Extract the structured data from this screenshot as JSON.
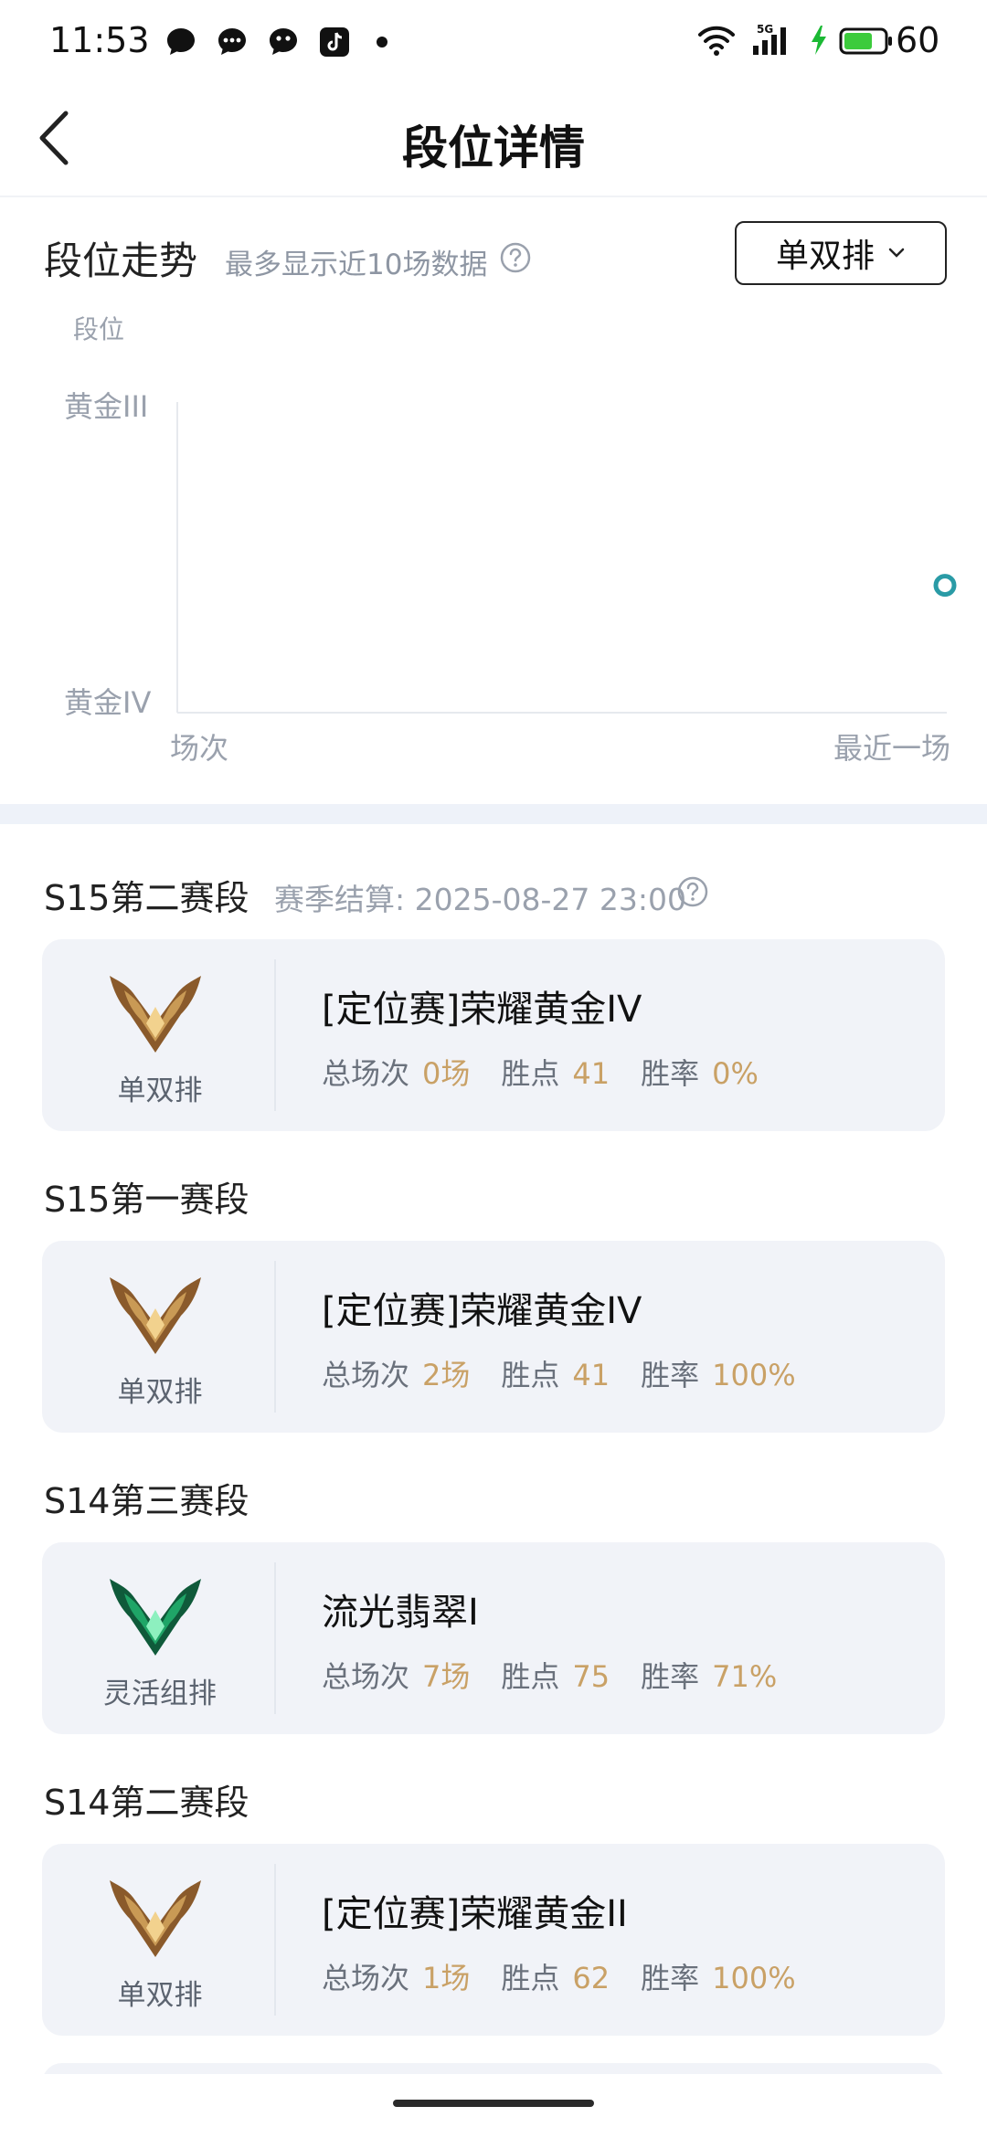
{
  "status_bar": {
    "time": "11:53",
    "network": "5G",
    "battery": "60",
    "notifications": [
      "chat-bubble-icon",
      "message-icon",
      "wechat-icon",
      "tiktok-icon",
      "dot-icon"
    ]
  },
  "header": {
    "title": "段位详情",
    "back_icon": "back-arrow-icon"
  },
  "trend": {
    "title": "段位走势",
    "subtitle": "最多显示近10场数据",
    "queue_selector": "单双排",
    "accent": "#2a9ba6"
  },
  "chart_data": {
    "type": "scatter",
    "title": "",
    "ylabel": "段位",
    "y_ticks": [
      "黄金IV",
      "黄金III"
    ],
    "xlabel": "场次",
    "x_end_label": "最近一场",
    "points": [
      {
        "x": "最近一场",
        "y": "黄金IV",
        "y_progress": 0.41
      }
    ],
    "grid": false
  },
  "seasons": [
    {
      "name": "S15第二赛段",
      "settlement": "赛季结算: 2025-08-27 23:00",
      "queue": "单双排",
      "rank": "[定位赛]荣耀黄金IV",
      "emblem": "gold-emblem-icon",
      "stats": {
        "games_label": "总场次",
        "games": "0场",
        "points_label": "胜点",
        "points": "41",
        "winrate_label": "胜率",
        "winrate": "0%"
      }
    },
    {
      "name": "S15第一赛段",
      "settlement": "",
      "queue": "单双排",
      "rank": "[定位赛]荣耀黄金IV",
      "emblem": "gold-emblem-icon",
      "stats": {
        "games_label": "总场次",
        "games": "2场",
        "points_label": "胜点",
        "points": "41",
        "winrate_label": "胜率",
        "winrate": "100%"
      }
    },
    {
      "name": "S14第三赛段",
      "settlement": "",
      "queue": "灵活组排",
      "rank": "流光翡翠I",
      "emblem": "emerald-emblem-icon",
      "stats": {
        "games_label": "总场次",
        "games": "7场",
        "points_label": "胜点",
        "points": "75",
        "winrate_label": "胜率",
        "winrate": "71%"
      }
    },
    {
      "name": "S14第二赛段",
      "settlement": "",
      "queue": "单双排",
      "rank": "[定位赛]荣耀黄金II",
      "emblem": "gold-emblem-icon",
      "stats": {
        "games_label": "总场次",
        "games": "1场",
        "points_label": "胜点",
        "points": "62",
        "winrate_label": "胜率",
        "winrate": "100%"
      }
    }
  ],
  "colors": {
    "value_gold": "#c9a166",
    "card_bg": "#f1f3f8",
    "muted": "#9aa1ad"
  }
}
